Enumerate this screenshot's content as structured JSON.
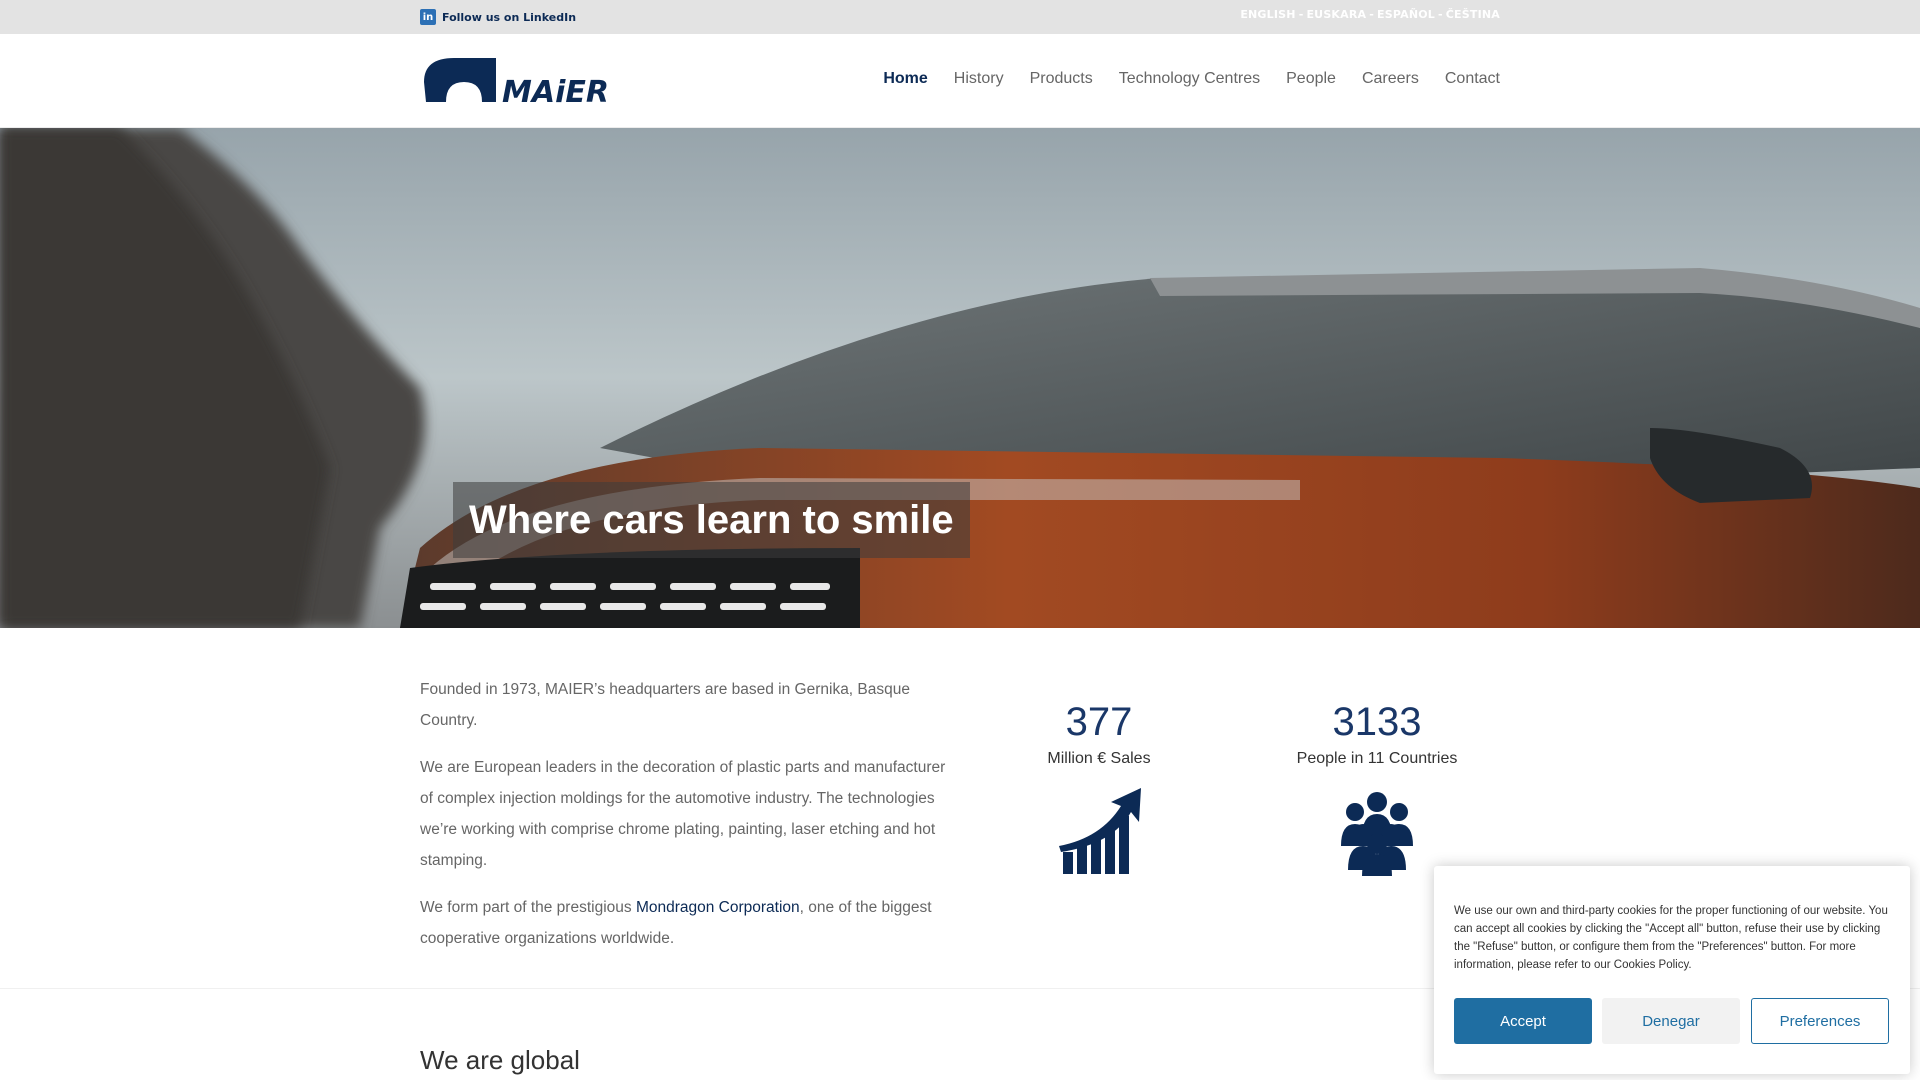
{
  "topbar": {
    "linkedin_icon": "linkedin-icon",
    "linkedin_label": "Follow us on LinkedIn",
    "languages": [
      "ENGLISH",
      "EUSKARA",
      "ESPAÑOL",
      "ČEŠTINA"
    ]
  },
  "header": {
    "logo_text": "MAiER",
    "nav": [
      {
        "label": "Home",
        "active": true
      },
      {
        "label": "History",
        "active": false
      },
      {
        "label": "Products",
        "active": false
      },
      {
        "label": "Technology Centres",
        "active": false
      },
      {
        "label": "People",
        "active": false
      },
      {
        "label": "Careers",
        "active": false
      },
      {
        "label": "Contact",
        "active": false
      }
    ]
  },
  "hero": {
    "title": "Where cars learn to smile"
  },
  "intro": {
    "p1": "Founded in 1973, MAIER’s headquarters are based in Gernika, Basque Country.",
    "p2": "We are European leaders in the decoration of plastic parts and manufacturer of complex injection moldings for the automotive industry. The technologies we’re working with comprise chrome plating, painting, laser etching and hot stamping.",
    "p3_before": "We form part of the prestigious ",
    "p3_link": "Mondragon Corporation",
    "p3_after": ", one of the biggest cooperative organizations worldwide."
  },
  "stats": [
    {
      "value": "377",
      "label": "Million € Sales",
      "icon": "growth-chart-icon"
    },
    {
      "value": "3133",
      "label": "People in 11 Countries",
      "icon": "people-group-icon"
    }
  ],
  "section2": {
    "title": "We are global"
  },
  "cookie": {
    "message": "We use our own and third-party cookies for the proper functioning of our website. You can accept all cookies by clicking the \"Accept all\" button, refuse their use by clicking the \"Refuse\" button, or configure them from the \"Preferences\" button. For more information, please refer to our Cookies Policy.",
    "accept": "Accept",
    "deny": "Denegar",
    "preferences": "Preferences"
  },
  "colors": {
    "brand_navy": "#0c2a55",
    "cookie_blue": "#1f6ea2",
    "topbar_bg": "#e3e3e3"
  }
}
